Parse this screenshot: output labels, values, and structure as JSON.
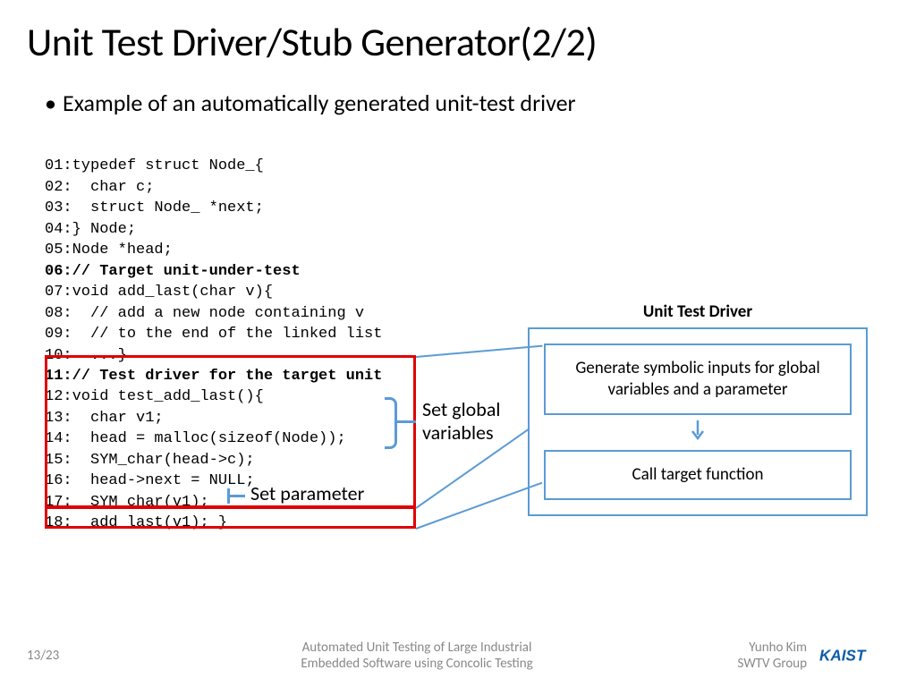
{
  "title": "Unit Test Driver/Stub Generator(2/2)",
  "bullet": "Example of an automatically generated unit-test driver",
  "code": {
    "l01": "01:typedef struct Node_{",
    "l02": "02:  char c;",
    "l03": "03:  struct Node_ *next;",
    "l04": "04:} Node;",
    "l05": "05:Node *head;",
    "l06": "06:// Target unit-under-test",
    "l07": "07:void add_last(char v){",
    "l08": "08:  // add a new node containing v",
    "l09": "09:  // to the end of the linked list",
    "l10": "10:  ...}",
    "l11": "11:// Test driver for the target unit",
    "l12": "12:void test_add_last(){",
    "l13": "13:  char v1;",
    "l14": "14:  head = malloc(sizeof(Node));",
    "l15": "15:  SYM_char(head->c);",
    "l16": "16:  head->next = NULL;",
    "l17": "17:  SYM_char(v1);",
    "l18": "18:  add_last(v1); }"
  },
  "labels": {
    "setGlobal": "Set global\nvariables",
    "setParam": "Set parameter"
  },
  "diagram": {
    "title": "Unit Test Driver",
    "box1": "Generate symbolic inputs for global variables and a parameter",
    "box2": "Call target function"
  },
  "footer": {
    "page": "13/23",
    "center": "Automated Unit Testing of Large Industrial\nEmbedded Software using Concolic Testing",
    "right": "Yunho Kim\nSWTV Group"
  }
}
